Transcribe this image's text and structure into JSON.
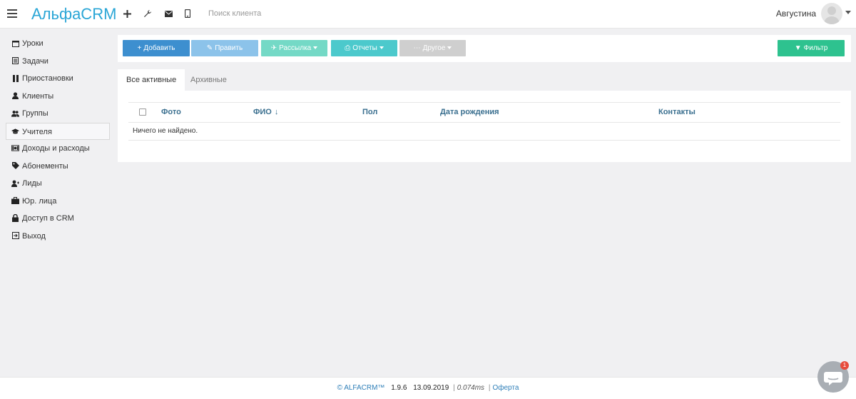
{
  "app": {
    "logo": "АльфаCRM",
    "search_placeholder": "Поиск клиента",
    "user_name": "Августина"
  },
  "sidebar": {
    "items": [
      {
        "label": "Уроки",
        "icon": "calendar-icon"
      },
      {
        "label": "Задачи",
        "icon": "task-list-icon"
      },
      {
        "label": "Приостановки",
        "icon": "pause-icon"
      },
      {
        "label": "Клиенты",
        "icon": "user-icon"
      },
      {
        "label": "Группы",
        "icon": "users-icon"
      },
      {
        "label": "Учителя",
        "icon": "graduation-cap-icon"
      },
      {
        "label": "Доходы и расходы",
        "icon": "money-icon"
      },
      {
        "label": "Абонементы",
        "icon": "tag-icon"
      },
      {
        "label": "Лиды",
        "icon": "user-plus-icon"
      },
      {
        "label": "Юр. лица",
        "icon": "briefcase-icon"
      },
      {
        "label": "Доступ в CRM",
        "icon": "lock-icon"
      },
      {
        "label": "Выход",
        "icon": "sign-out-icon"
      }
    ],
    "active_index": 5
  },
  "toolbar": {
    "add_label": "Добавить",
    "edit_label": "Править",
    "mailing_label": "Рассылка",
    "reports_label": "Отчеты",
    "other_label": "Другое",
    "filter_label": "Фильтр"
  },
  "colors": {
    "add": "#3d8fcf",
    "edit": "#8cc3ea",
    "mailing": "#74d9c6",
    "reports": "#4cc9cc",
    "other": "#cfcfcf",
    "filter": "#2ec28f",
    "brand": "#2aa6d6"
  },
  "tabs": [
    {
      "label": "Все активные",
      "active": true
    },
    {
      "label": "Архивные",
      "active": false
    }
  ],
  "table": {
    "columns": [
      "Фото",
      "ФИО",
      "Пол",
      "Дата рождения",
      "Контакты"
    ],
    "sort_indicator": "↓",
    "empty_message": "Ничего не найдено."
  },
  "footer": {
    "brand": "© ALFACRM™",
    "version": "1.9.6",
    "date": "13.09.2019",
    "sep": "|",
    "timing": "0.074ms",
    "link": "Оферта"
  },
  "chat": {
    "badge": "1"
  }
}
